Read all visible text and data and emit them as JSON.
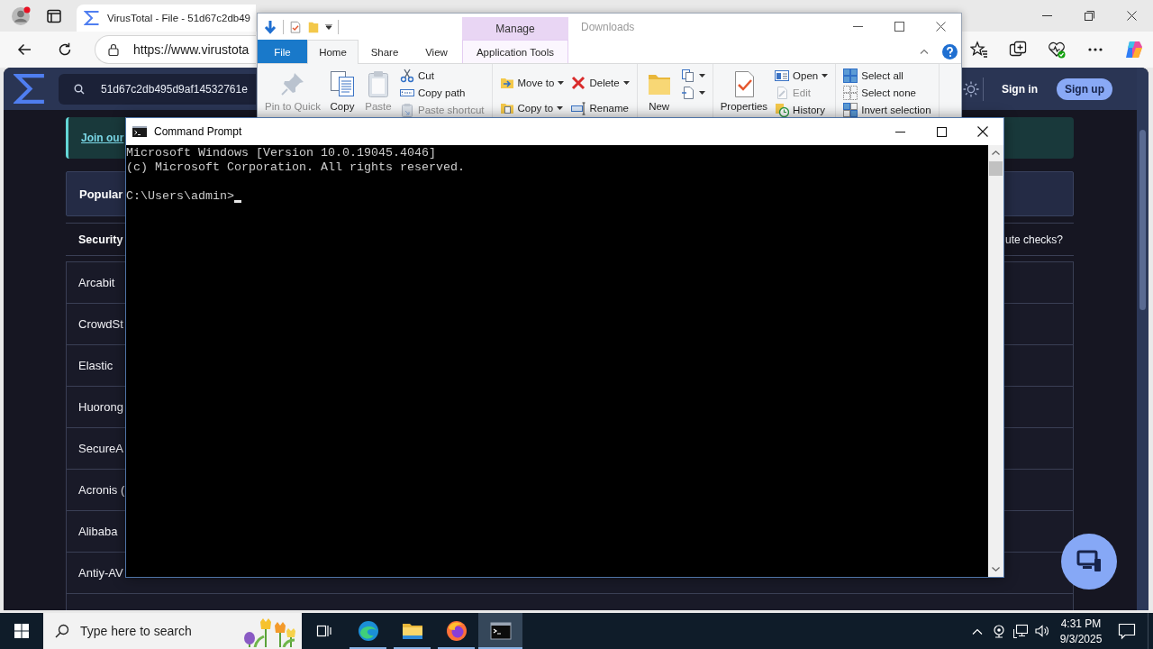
{
  "browser": {
    "tabs": [
      {
        "title": "VirusTotal - File - 51d67c2db49",
        "selected": true
      }
    ],
    "address": "https://www.virustota"
  },
  "page": {
    "search_value": "51d67c2db495d9af14532761e",
    "sign_in": "Sign in",
    "sign_up": "Sign up",
    "banner_link": "Join our",
    "panel_label": "Popular",
    "section_title": "Security",
    "section_link": "ute checks?",
    "vendors": [
      "Arcabit",
      "CrowdSt",
      "Elastic",
      "Huorong",
      "SecureA",
      "Acronis (",
      "Alibaba",
      "Antiy-AV"
    ]
  },
  "explorer": {
    "title": "Downloads",
    "context_group": "Manage",
    "tabs": [
      {
        "label": "File",
        "kind": "file",
        "selected": false
      },
      {
        "label": "Home",
        "kind": "plain",
        "selected": true
      },
      {
        "label": "Share",
        "kind": "plain",
        "selected": false
      },
      {
        "label": "View",
        "kind": "plain",
        "selected": false
      },
      {
        "label": "Application Tools",
        "kind": "contextual",
        "selected": false
      }
    ],
    "ribbon": [
      {
        "columns": [
          {
            "kind": "large",
            "items": [
              {
                "label": "Pin to Quick",
                "disabled": true,
                "menu": false
              }
            ]
          },
          {
            "kind": "large",
            "items": [
              {
                "label": "Copy",
                "disabled": false,
                "menu": false
              }
            ]
          },
          {
            "kind": "large",
            "items": [
              {
                "label": "Paste",
                "disabled": true,
                "menu": false
              }
            ]
          },
          {
            "kind": "small",
            "items": [
              {
                "label": "Cut",
                "disabled": false,
                "menu": false
              },
              {
                "label": "Copy path",
                "disabled": false,
                "menu": false
              },
              {
                "label": "Paste shortcut",
                "disabled": true,
                "menu": false
              }
            ]
          }
        ]
      },
      {
        "columns": [
          {
            "kind": "medium",
            "items": [
              {
                "label": "Move to",
                "disabled": false,
                "menu": true
              },
              {
                "label": "Copy to",
                "disabled": false,
                "menu": true
              }
            ]
          },
          {
            "kind": "medium",
            "items": [
              {
                "label": "Delete",
                "disabled": false,
                "menu": true
              },
              {
                "label": "Rename",
                "disabled": false,
                "menu": false
              }
            ]
          }
        ]
      },
      {
        "columns": [
          {
            "kind": "large",
            "items": [
              {
                "label": "New",
                "disabled": false,
                "menu": false
              }
            ]
          },
          {
            "kind": "small",
            "items": [
              {
                "disabled": false,
                "menu": true
              },
              {
                "disabled": false,
                "menu": true
              }
            ]
          }
        ]
      },
      {
        "columns": [
          {
            "kind": "large",
            "items": [
              {
                "label": "Properties",
                "disabled": false,
                "menu": false
              }
            ]
          },
          {
            "kind": "small",
            "items": [
              {
                "label": "Open",
                "disabled": false,
                "menu": true
              },
              {
                "label": "Edit",
                "disabled": true,
                "menu": false
              },
              {
                "label": "History",
                "disabled": false,
                "menu": false
              }
            ]
          }
        ]
      },
      {
        "columns": [
          {
            "kind": "small",
            "items": [
              {
                "label": "Select all",
                "disabled": false,
                "menu": false
              },
              {
                "label": "Select none",
                "disabled": false,
                "menu": false
              },
              {
                "label": "Invert selection",
                "disabled": false,
                "menu": false
              }
            ]
          }
        ]
      }
    ]
  },
  "cmd": {
    "title": "Command Prompt",
    "output": [
      "Microsoft Windows [Version 10.0.19045.4046]",
      "(c) Microsoft Corporation. All rights reserved."
    ],
    "prompt": "C:\\Users\\admin>"
  },
  "taskbar": {
    "search_placeholder": "Type here to search",
    "apps": [
      {
        "running": true,
        "selected": false
      },
      {
        "running": true,
        "selected": false
      },
      {
        "running": true,
        "selected": false
      },
      {
        "running": true,
        "selected": true
      }
    ],
    "time": "4:31 PM",
    "date": "9/3/2025"
  }
}
